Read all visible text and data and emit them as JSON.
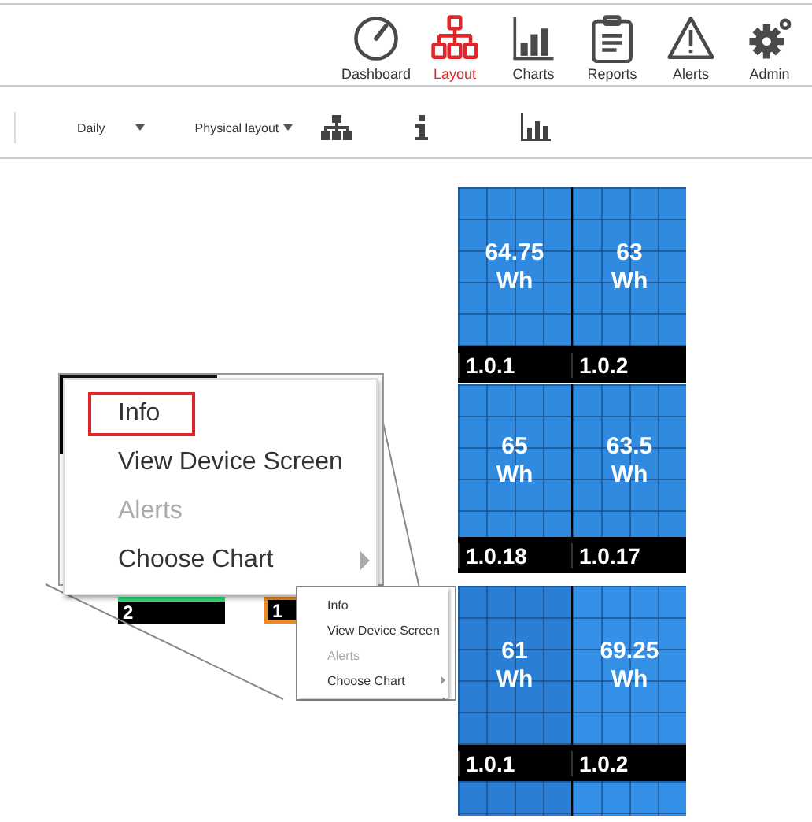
{
  "nav": [
    {
      "label": "Dashboard",
      "selected": false
    },
    {
      "label": "Layout",
      "selected": true
    },
    {
      "label": "Charts",
      "selected": false
    },
    {
      "label": "Reports",
      "selected": false
    },
    {
      "label": "Alerts",
      "selected": false
    },
    {
      "label": "Admin",
      "selected": false
    }
  ],
  "toolbar": {
    "period": "Daily",
    "view": "Physical layout"
  },
  "panels": [
    {
      "cells": [
        {
          "value": "64.75",
          "unit": "Wh",
          "label": "1.0.1",
          "color": "#2f8ae0"
        },
        {
          "value": "63",
          "unit": "Wh",
          "label": "1.0.2",
          "color": "#2f8ae0"
        }
      ]
    },
    {
      "cells": [
        {
          "value": "65",
          "unit": "Wh",
          "label": "1.0.18",
          "color": "#2f8ae0"
        },
        {
          "value": "63.5",
          "unit": "Wh",
          "label": "1.0.17",
          "color": "#2f8ae0"
        }
      ]
    },
    {
      "cells": [
        {
          "value": "61",
          "unit": "Wh",
          "label": "1.0.1",
          "color": "#2a7fd4"
        },
        {
          "value": "69.25",
          "unit": "Wh",
          "label": "1.0.2",
          "color": "#3590e8"
        }
      ]
    }
  ],
  "small_tiles": [
    {
      "label": "2",
      "selected": false
    },
    {
      "label": "1",
      "selected": true
    }
  ],
  "zoomed_menu": [
    {
      "label": "Info",
      "disabled": false,
      "selected": true
    },
    {
      "label": "View Device Screen",
      "disabled": false,
      "selected": false
    },
    {
      "label": "Alerts",
      "disabled": true,
      "selected": false
    },
    {
      "label": "Choose Chart",
      "disabled": false,
      "selected": false,
      "submenu": true
    }
  ],
  "context_menu": [
    {
      "label": "Info",
      "disabled": false,
      "selected": false
    },
    {
      "label": "View Device Screen",
      "disabled": false,
      "selected": false
    },
    {
      "label": "Alerts",
      "disabled": true,
      "selected": false
    },
    {
      "label": "Choose Chart",
      "disabled": false,
      "selected": false,
      "submenu": true
    }
  ]
}
